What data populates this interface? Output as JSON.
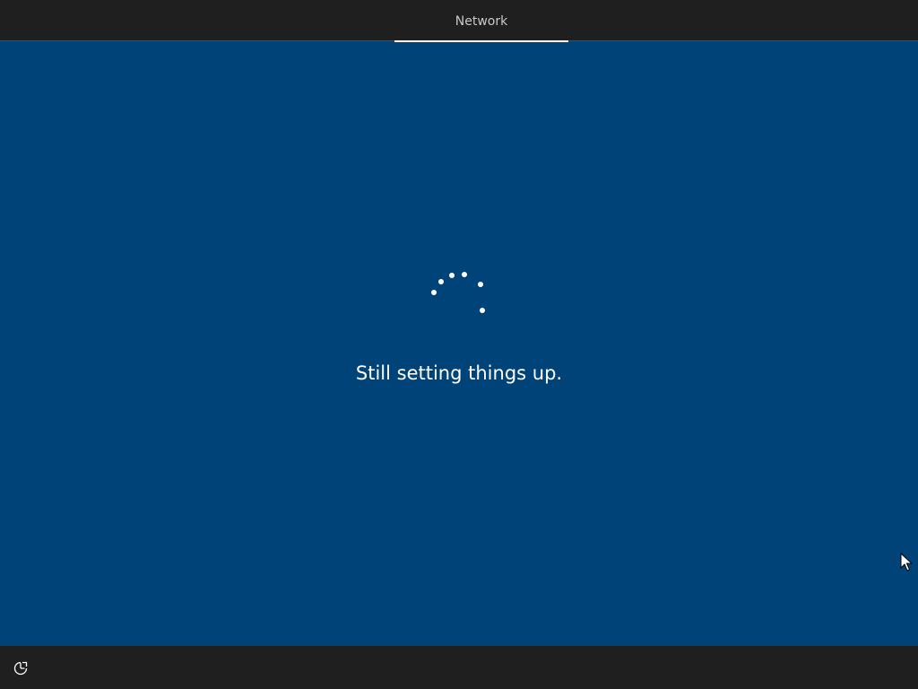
{
  "header": {
    "active_tab": "Network"
  },
  "main": {
    "status_text": "Still setting things up."
  },
  "footer": {
    "ease_of_access_icon": "ease-of-access-icon"
  },
  "colors": {
    "background": "#004378",
    "bar": "#1f1f1f",
    "text": "#ffffff"
  }
}
